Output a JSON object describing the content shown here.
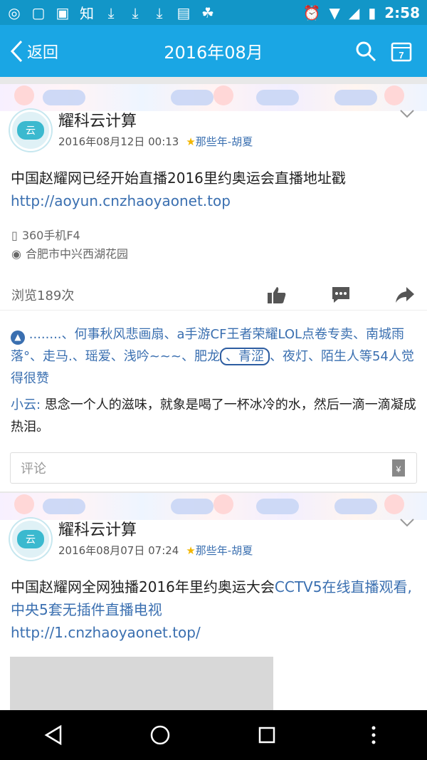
{
  "status_bar": {
    "time": "2:58"
  },
  "app_bar": {
    "back_label": "返回",
    "title": "2016年08月",
    "calendar_day": "7"
  },
  "posts": [
    {
      "author": "耀科云计算",
      "avatar_text": "云",
      "date": "2016年08月12日 00:13",
      "source": "那些年-胡夏",
      "text": "中国赵耀网已经开始直播2016里约奥运会直播地址戳",
      "link": "http://aoyun.cnzhaoyaonet.top",
      "device": "360手机F4",
      "location": "合肥市中兴西湖花园",
      "views": "浏览189次",
      "likes_prefix": "........、何事秋风悲画扇、a手游CF王者荣耀LOL点卷专卖、南城雨落°、走马.、瑶爱、浅吟~~~、肥龙",
      "likes_circled": "、青涩",
      "likes_suffix": "、夜灯、陌生人等54人觉得很赞",
      "comment_author": "小云:",
      "comment_text": "思念一个人的滋味，就象是喝了一杯冰冷的水，然后一滴一滴凝成热泪。",
      "comment_placeholder": "评论"
    },
    {
      "author": "耀科云计算",
      "avatar_text": "云",
      "date": "2016年08月07日 07:24",
      "source": "那些年-胡夏",
      "text": "中国赵耀网全网独播2016年里约奥运大会",
      "text_link": "CCTV5在线直播观看,中央5套无插件直播电视",
      "link": "http://1.cnzhaoyaonet.top/"
    }
  ]
}
